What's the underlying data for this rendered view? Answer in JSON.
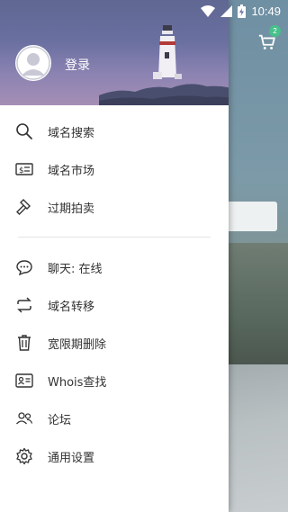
{
  "status_bar": {
    "time": "10:49"
  },
  "background": {
    "cart_badge": "2"
  },
  "drawer": {
    "login_label": "登录",
    "group1": [
      {
        "label": "域名搜索",
        "icon": "search-icon"
      },
      {
        "label": "域名市场",
        "icon": "dollar-tag-icon"
      },
      {
        "label": "过期拍卖",
        "icon": "gavel-icon"
      }
    ],
    "group2": [
      {
        "label": "聊天: 在线",
        "icon": "chat-icon"
      },
      {
        "label": "域名转移",
        "icon": "transfer-icon"
      },
      {
        "label": "宽限期删除",
        "icon": "trash-icon"
      },
      {
        "label": "Whois查找",
        "icon": "id-card-icon"
      },
      {
        "label": "论坛",
        "icon": "users-icon"
      },
      {
        "label": "通用设置",
        "icon": "settings-gear-icon"
      }
    ]
  },
  "colors": {
    "drawer_text": "#333333",
    "badge": "#47c08a"
  }
}
